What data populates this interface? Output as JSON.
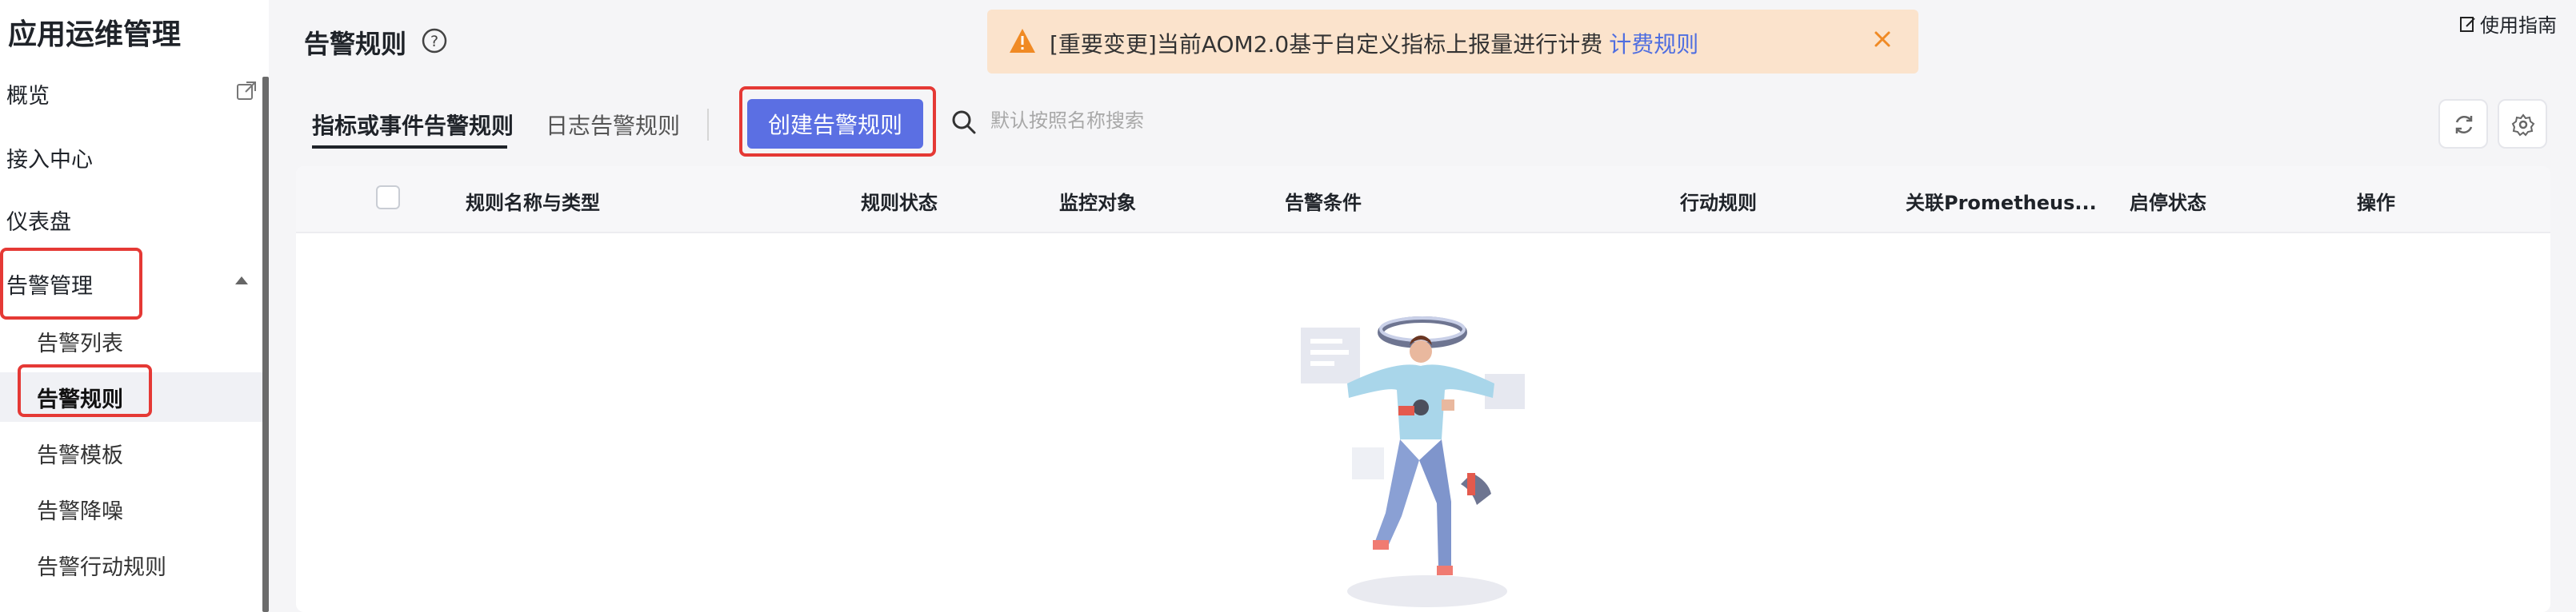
{
  "sidebar": {
    "app_title": "应用运维管理",
    "items": [
      {
        "label": "概览"
      },
      {
        "label": "接入中心"
      },
      {
        "label": "仪表盘"
      },
      {
        "label": "告警管理"
      }
    ],
    "sub_items": [
      {
        "label": "告警列表"
      },
      {
        "label": "告警规则"
      },
      {
        "label": "告警模板"
      },
      {
        "label": "告警降噪"
      },
      {
        "label": "告警行动规则"
      }
    ]
  },
  "header": {
    "title": "告警规则",
    "guide_label": "使用指南"
  },
  "banner": {
    "text": "[重要变更]当前AOM2.0基于自定义指标上报量进行计费",
    "link": "计费规则"
  },
  "tabs": [
    {
      "label": "指标或事件告警规则"
    },
    {
      "label": "日志告警规则"
    }
  ],
  "toolbar": {
    "create_label": "创建告警规则",
    "search_placeholder": "默认按照名称搜索"
  },
  "table": {
    "columns": [
      "规则名称与类型",
      "规则状态",
      "监控对象",
      "告警条件",
      "行动规则",
      "关联Prometheus...",
      "启停状态",
      "操作"
    ]
  },
  "colors": {
    "primary": "#5b6fe3",
    "banner_bg": "#fbe3cc",
    "highlight_border": "#e53935",
    "link": "#4f6ee0"
  }
}
